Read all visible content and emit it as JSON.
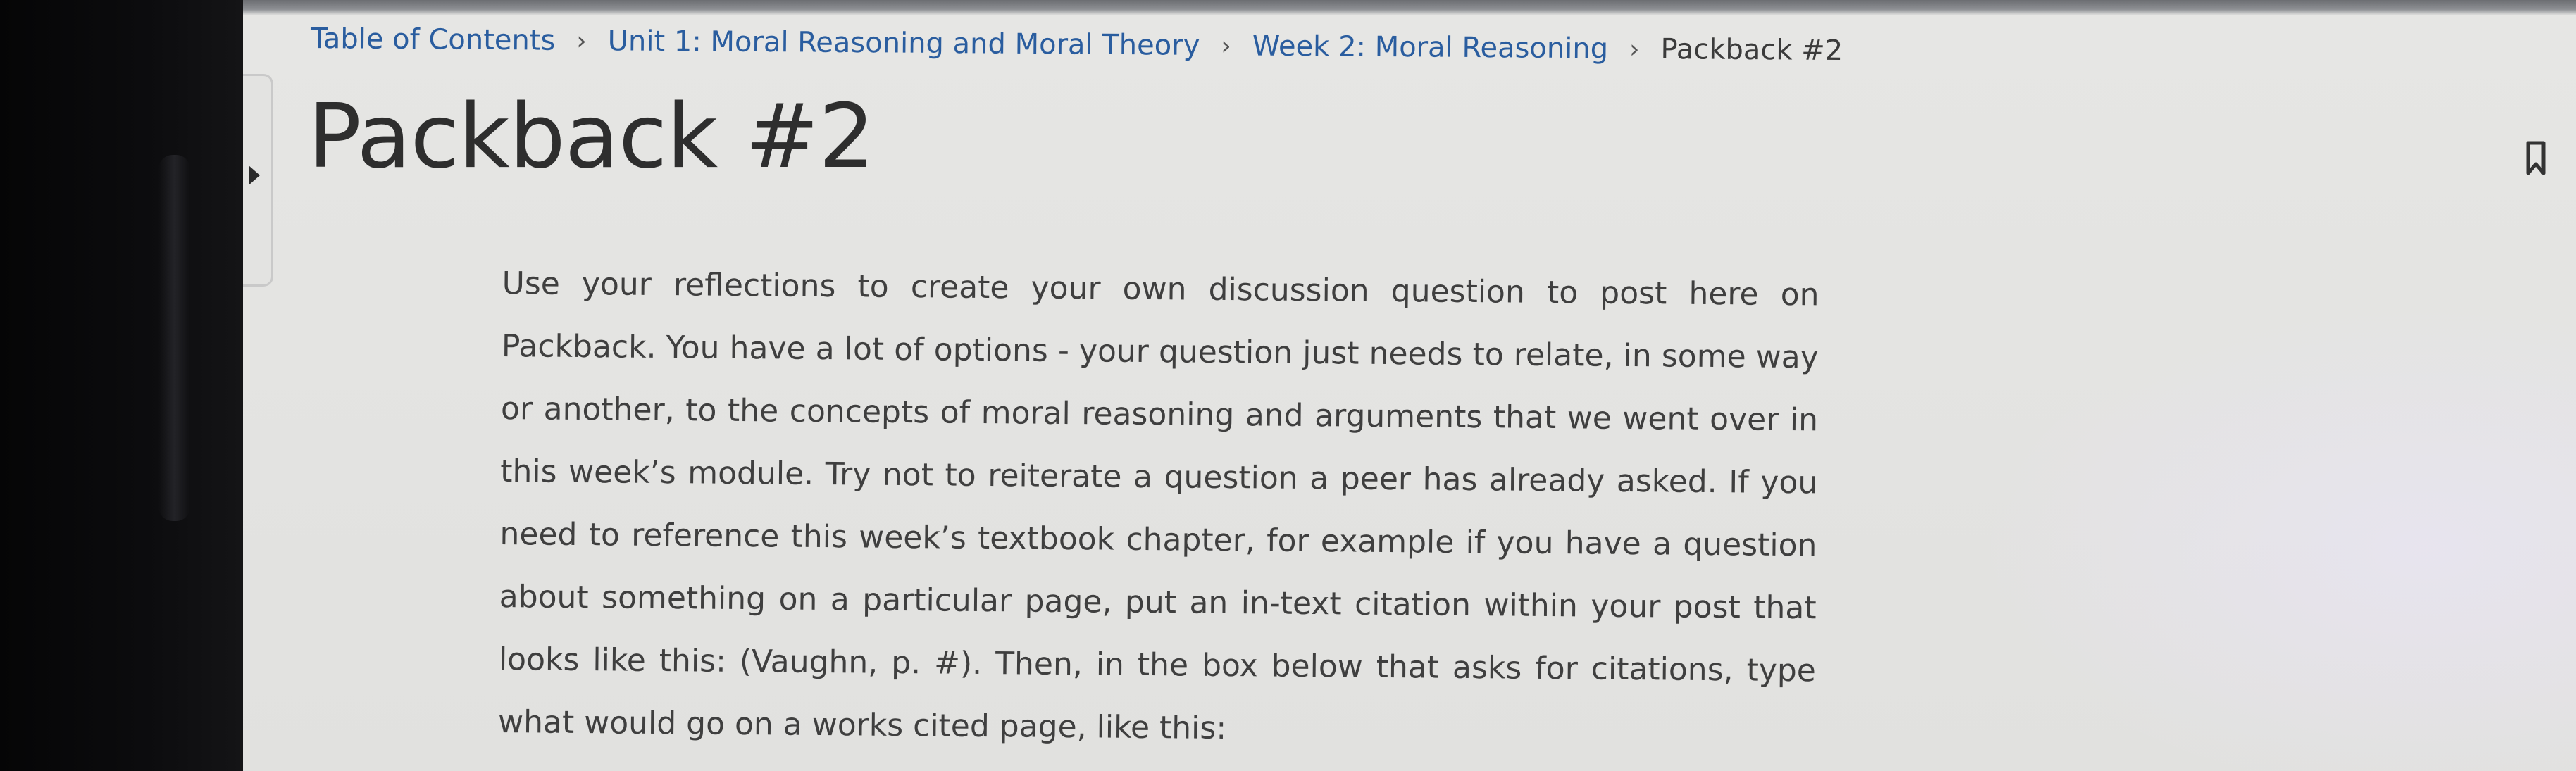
{
  "breadcrumb": {
    "items": [
      {
        "label": "Table of Contents"
      },
      {
        "label": "Unit 1: Moral Reasoning and Moral Theory"
      },
      {
        "label": "Week 2: Moral Reasoning"
      }
    ],
    "separator": "›",
    "current": "Packback #2"
  },
  "page": {
    "title": "Packback #2"
  },
  "toolbar": {
    "bookmark_icon": "bookmark-icon",
    "expand_icon": "expand-icon",
    "previous_icon": "chevron-left-icon"
  },
  "content": {
    "body": "Use your reflections to create your own discussion question to post here on Packback. You have a lot of options - your question just needs to relate, in some way or another, to the concepts of moral reasoning and arguments that we went over in this week’s module. Try not to reiterate a question a peer has already asked. If you need to reference this week’s textbook chapter, for example if you have a question about something on a particular page, put an in-text citation within your post that looks like this: (Vaughn, p. #). Then, in the box below that asks for citations, type what would go on a works cited page, like this:"
  },
  "colors": {
    "link": "#2a5d9f",
    "title": "#2e2e2e",
    "text": "#3f3f3f",
    "page_bg": "#e4e4e2"
  }
}
